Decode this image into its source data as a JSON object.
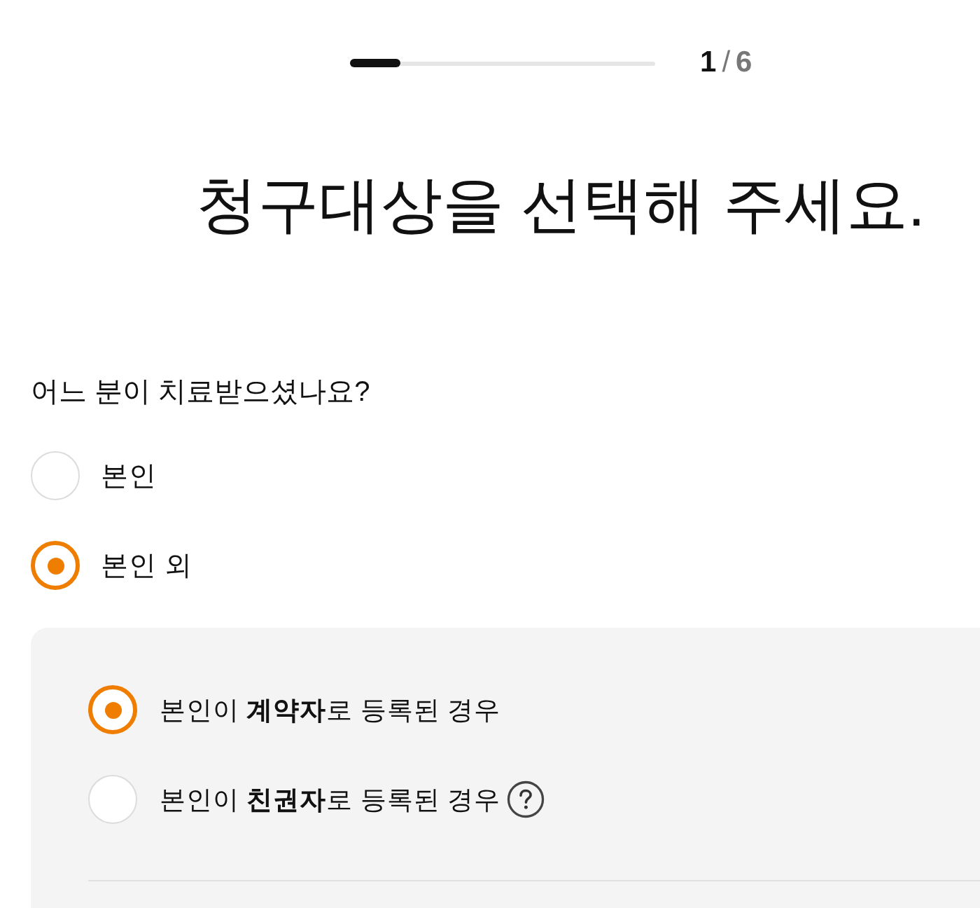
{
  "progress": {
    "level": 0.167,
    "current": "1",
    "separator": "/",
    "total": "6"
  },
  "title": "청구대상을 선택해 주세요.",
  "question": "어느 분이 치료받으셨나요?",
  "options": [
    {
      "label": "본인",
      "selected": false
    },
    {
      "label": "본인 외",
      "selected": true
    }
  ],
  "sub_options": [
    {
      "label": "본인이 **계약자**로 등록된 경우",
      "selected": true,
      "help": false
    },
    {
      "label": "본인이 **친권자**로 등록된 경우",
      "selected": false,
      "help": true
    }
  ]
}
